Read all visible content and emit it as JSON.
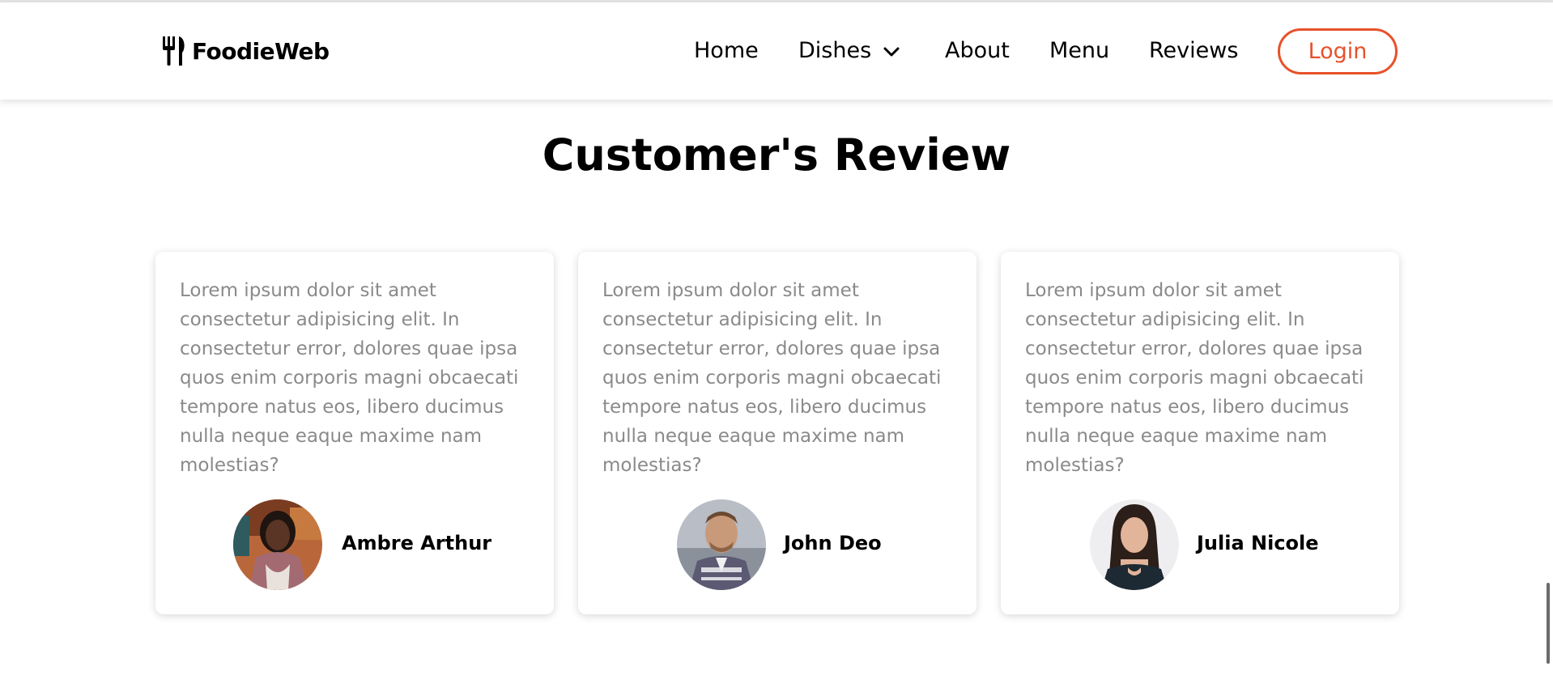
{
  "header": {
    "logo_text": "FoodieWeb",
    "logo_icon": "fork-knife-icon",
    "nav": {
      "home": "Home",
      "dishes": "Dishes",
      "about": "About",
      "menu": "Menu",
      "reviews": "Reviews"
    },
    "login_label": "Login"
  },
  "section": {
    "title": "Customer's Review"
  },
  "reviews": [
    {
      "text": "Lorem ipsum dolor sit amet consectetur adipisicing elit. In consectetur error, dolores quae ipsa quos enim corporis magni obcaecati tempore natus eos, libero ducimus nulla neque eaque maxime nam molestias?",
      "name": "Ambre Arthur"
    },
    {
      "text": "Lorem ipsum dolor sit amet consectetur adipisicing elit. In consectetur error, dolores quae ipsa quos enim corporis magni obcaecati tempore natus eos, libero ducimus nulla neque eaque maxime nam molestias?",
      "name": "John Deo"
    },
    {
      "text": "Lorem ipsum dolor sit amet consectetur adipisicing elit. In consectetur error, dolores quae ipsa quos enim corporis magni obcaecati tempore natus eos, libero ducimus nulla neque eaque maxime nam molestias?",
      "name": "Julia Nicole"
    }
  ],
  "colors": {
    "accent": "#e8512a",
    "body_text": "#8a8a8a",
    "heading": "#000000"
  }
}
